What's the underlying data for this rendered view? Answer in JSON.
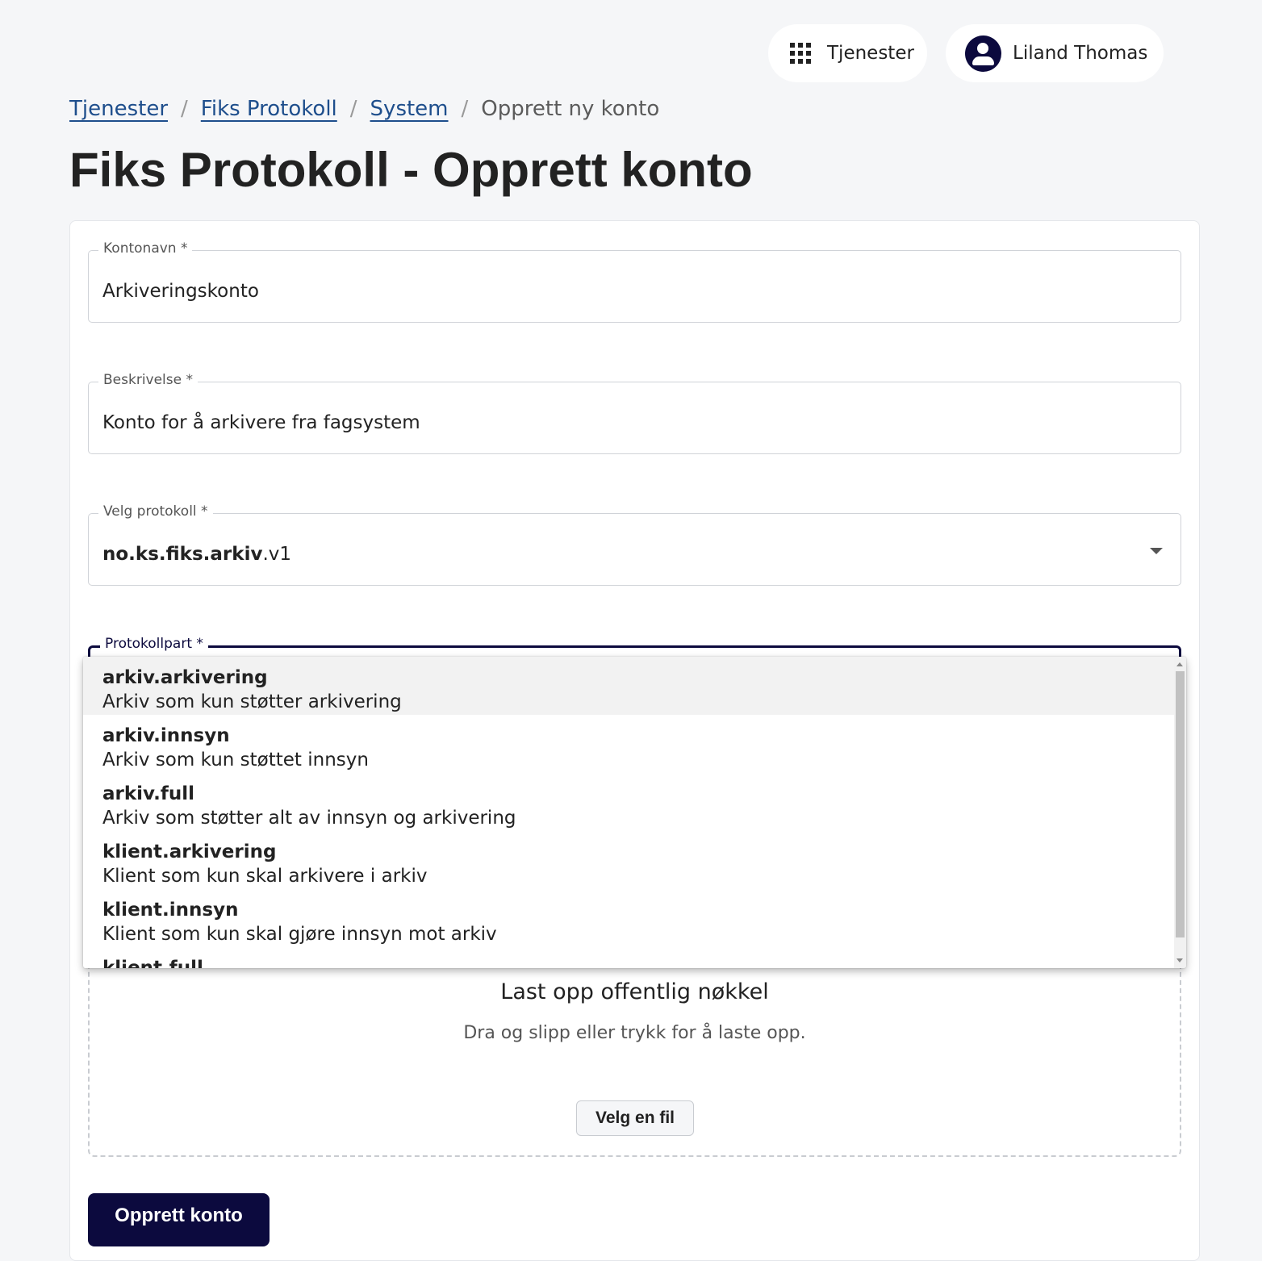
{
  "header": {
    "services_label": "Tjenester",
    "user_name": "Liland Thomas"
  },
  "breadcrumb": {
    "items": [
      "Tjenester",
      "Fiks Protokoll",
      "System"
    ],
    "separator": "/",
    "current": "Opprett ny konto"
  },
  "page_title": "Fiks Protokoll - Opprett konto",
  "form": {
    "kontonavn": {
      "label": "Kontonavn *",
      "value": "Arkiveringskonto"
    },
    "beskrivelse": {
      "label": "Beskrivelse *",
      "value": "Konto for å arkivere fra fagsystem"
    },
    "protokoll": {
      "label": "Velg protokoll *",
      "value_bold": "no.ks.fiks.arkiv",
      "value_rest": ".v1"
    },
    "protokollpart": {
      "label": "Protokollpart *"
    }
  },
  "dropdown": {
    "options": [
      {
        "name": "arkiv.arkivering",
        "description": "Arkiv som kun støtter arkivering"
      },
      {
        "name": "arkiv.innsyn",
        "description": "Arkiv som kun støttet innsyn"
      },
      {
        "name": "arkiv.full",
        "description": "Arkiv som støtter alt av innsyn og arkivering"
      },
      {
        "name": "klient.arkivering",
        "description": "Klient som kun skal arkivere i arkiv"
      },
      {
        "name": "klient.innsyn",
        "description": "Klient som kun skal gjøre innsyn mot arkiv"
      },
      {
        "name": "klient.full",
        "description": ""
      }
    ],
    "highlighted_index": 0
  },
  "upload": {
    "title": "Last opp offentlig nøkkel",
    "hint": "Dra og slipp eller trykk for å laste opp.",
    "button_label": "Velg en fil"
  },
  "submit_label": "Opprett konto",
  "colors": {
    "primary": "#0c0a3e",
    "link": "#1e4e8c",
    "background": "#f5f6f8"
  }
}
